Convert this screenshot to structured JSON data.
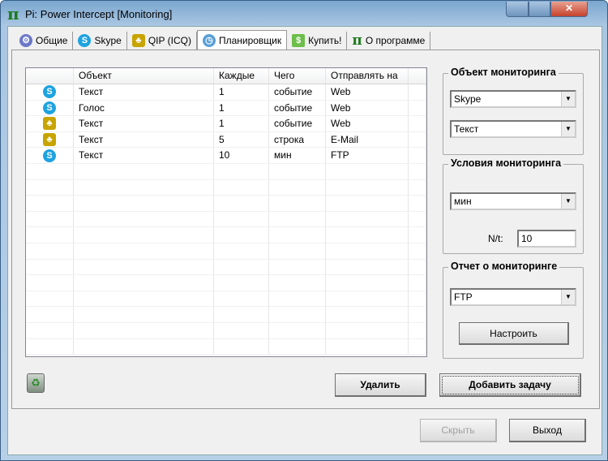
{
  "window": {
    "title": "Pi: Power Intercept [Monitoring]"
  },
  "tabs": [
    {
      "label": "Общие",
      "icon": "gear-icon"
    },
    {
      "label": "Skype",
      "icon": "skype-icon"
    },
    {
      "label": "QIP (ICQ)",
      "icon": "qip-icon"
    },
    {
      "label": "Планировщик",
      "icon": "alarm-clock-icon"
    },
    {
      "label": "Купить!",
      "icon": "money-icon"
    },
    {
      "label": "О программе",
      "icon": "pi-icon"
    }
  ],
  "table": {
    "headers": [
      "",
      "Объект",
      "Каждые",
      "Чего",
      "Отправлять на"
    ],
    "rows": [
      {
        "app": "skype",
        "object": "Текст",
        "every": "1",
        "what": "событие",
        "send_to": "Web"
      },
      {
        "app": "skype",
        "object": "Голос",
        "every": "1",
        "what": "событие",
        "send_to": "Web"
      },
      {
        "app": "qip",
        "object": "Текст",
        "every": "1",
        "what": "событие",
        "send_to": "Web"
      },
      {
        "app": "qip",
        "object": "Текст",
        "every": "5",
        "what": "строка",
        "send_to": "E-Mail"
      },
      {
        "app": "skype",
        "object": "Текст",
        "every": "10",
        "what": "мин",
        "send_to": "FTP"
      }
    ]
  },
  "monitoring_object": {
    "label": "Объект мониторинга",
    "app": "Skype",
    "type": "Текст"
  },
  "monitoring_conditions": {
    "label": "Условия мониторинга",
    "unit": "мин",
    "n_label": "N/t:",
    "n_value": "10"
  },
  "monitoring_report": {
    "label": "Отчет о мониторинге",
    "target": "FTP",
    "configure": "Настроить"
  },
  "buttons": {
    "delete": "Удалить",
    "add_task": "Добавить задачу",
    "hide": "Скрыть",
    "exit": "Выход"
  },
  "colors": {
    "skype": "#1ea3e0",
    "qip": "#c8a400"
  }
}
